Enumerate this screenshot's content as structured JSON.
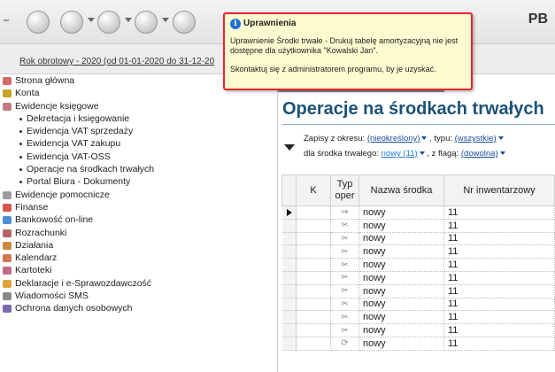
{
  "toolbar": {
    "icons": [
      "home-icon",
      "tag-icon",
      "tools-icon",
      "printer-icon",
      "help-icon"
    ],
    "user_initials": "PB"
  },
  "year_link": "Rok obrotowy - 2020  (od 01-01-2020 do 31-12-20",
  "sidebar": {
    "items": [
      {
        "label": "Strona główna",
        "level": 0,
        "icon": "home-icon",
        "color": "#d46a6a"
      },
      {
        "label": "Konta",
        "level": 0,
        "icon": "accounts-icon",
        "color": "#c9a227"
      },
      {
        "label": "Ewidencje księgowe",
        "level": 0,
        "icon": "ledger-icon",
        "color": "#c47a85"
      },
      {
        "label": "Dekretacja i księgowanie",
        "level": 1
      },
      {
        "label": "Ewidencja VAT sprzedaży",
        "level": 1
      },
      {
        "label": "Ewidencja VAT zakupu",
        "level": 1
      },
      {
        "label": "Ewidencja VAT-OSS",
        "level": 1
      },
      {
        "label": "Operacje na środkach trwałych",
        "level": 1
      },
      {
        "label": "Portal Biura - Dokumenty",
        "level": 1
      },
      {
        "label": "Ewidencje pomocnicze",
        "level": 0,
        "icon": "aux-ledger-icon",
        "color": "#9b9b9b"
      },
      {
        "label": "Finanse",
        "level": 0,
        "icon": "finance-icon",
        "color": "#d4554f"
      },
      {
        "label": "Bankowość on-line",
        "level": 0,
        "icon": "bank-icon",
        "color": "#4d8fd1"
      },
      {
        "label": "Rozrachunki",
        "level": 0,
        "icon": "settlements-icon",
        "color": "#b56565"
      },
      {
        "label": "Działania",
        "level": 0,
        "icon": "actions-icon",
        "color": "#c98a3f"
      },
      {
        "label": "Kalendarz",
        "level": 0,
        "icon": "calendar-icon",
        "color": "#d07850"
      },
      {
        "label": "Kartoteki",
        "level": 0,
        "icon": "files-icon",
        "color": "#c46a8c"
      },
      {
        "label": "Deklaracje i e-Sprawozdawczość",
        "level": 0,
        "icon": "declarations-icon",
        "color": "#e0a33a"
      },
      {
        "label": "Wiadomości SMS",
        "level": 0,
        "icon": "sms-icon",
        "color": "#8a8a8a"
      },
      {
        "label": "Ochrona danych osobowych",
        "level": 0,
        "icon": "privacy-icon",
        "color": "#7a6ab0"
      }
    ]
  },
  "tooltip": {
    "title": "Uprawnienia",
    "body": "Uprawnienie Środki trwałe - Drukuj tabelę amortyzacyjną nie jest dostępne dla użytkownika \"Kowalski Jan\".",
    "contact": "Skontaktuj się z administratorem programu, by je uzyskać."
  },
  "main": {
    "title": "Operacje na środkach trwałych",
    "filters": {
      "period_label": "Zapisy z okresu:",
      "period_value": "(nieokreślony)",
      "type_label": ", typu:",
      "type_value": "(wszystkie)",
      "asset_label": "dla środka trwałego:",
      "asset_value": "nowy (11)",
      "flag_label": ", z flagą:",
      "flag_value": "(dowolna)"
    },
    "columns": {
      "k": "K",
      "typ": "Typ oper",
      "nazwa": "Nazwa środka",
      "nr": "Nr inwentarzowy"
    },
    "rows": [
      {
        "op_icon": "arrow-right-icon",
        "glyph": "⇒",
        "nazwa": "nowy",
        "nr": "11",
        "current": true
      },
      {
        "op_icon": "scissors-icon",
        "glyph": "✂",
        "nazwa": "nowy",
        "nr": "11"
      },
      {
        "op_icon": "scissors-icon",
        "glyph": "✂",
        "nazwa": "nowy",
        "nr": "11"
      },
      {
        "op_icon": "scissors-icon",
        "glyph": "✂",
        "nazwa": "nowy",
        "nr": "11"
      },
      {
        "op_icon": "scissors-icon",
        "glyph": "✂",
        "nazwa": "nowy",
        "nr": "11"
      },
      {
        "op_icon": "scissors-icon",
        "glyph": "✂",
        "nazwa": "nowy",
        "nr": "11"
      },
      {
        "op_icon": "scissors-icon",
        "glyph": "✂",
        "nazwa": "nowy",
        "nr": "11"
      },
      {
        "op_icon": "scissors-icon",
        "glyph": "✂",
        "nazwa": "nowy",
        "nr": "11"
      },
      {
        "op_icon": "scissors-icon",
        "glyph": "✂",
        "nazwa": "nowy",
        "nr": "11"
      },
      {
        "op_icon": "scissors-icon",
        "glyph": "✂",
        "nazwa": "nowy",
        "nr": "11"
      },
      {
        "op_icon": "refresh-icon",
        "glyph": "⟳",
        "nazwa": "nowy",
        "nr": "11"
      }
    ]
  }
}
